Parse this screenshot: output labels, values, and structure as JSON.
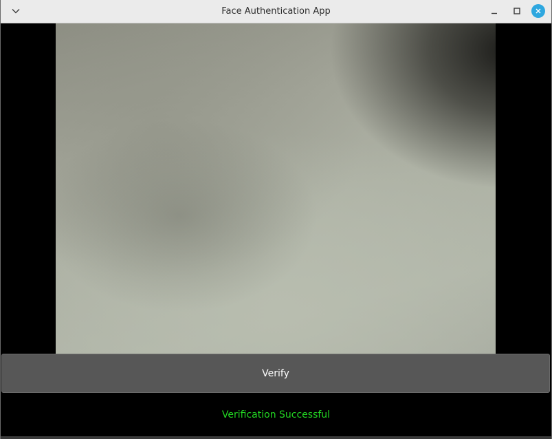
{
  "window": {
    "title": "Face Authentication App"
  },
  "titlebar": {
    "menu_icon": "chevron-down-icon",
    "minimize_icon": "minimize-icon",
    "maximize_icon": "maximize-icon",
    "close_icon": "close-icon",
    "close_color": "#2ea7df"
  },
  "camera": {
    "feed": "live-camera-feed"
  },
  "actions": {
    "verify_label": "Verify"
  },
  "status": {
    "message": "Verification Successful",
    "color": "#22d622"
  }
}
